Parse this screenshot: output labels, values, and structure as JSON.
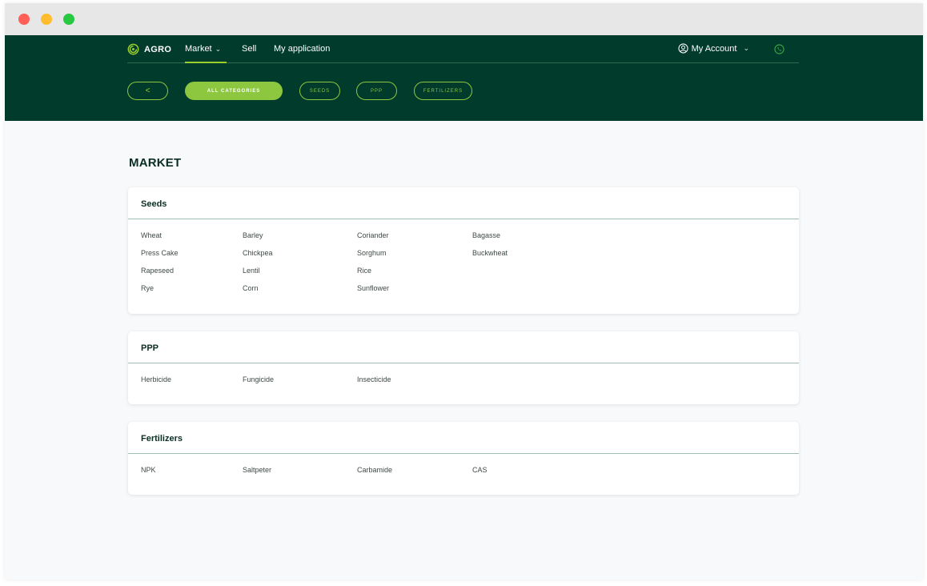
{
  "brand": {
    "name": "AGRO"
  },
  "nav": {
    "market": "Market",
    "sell": "Sell",
    "my_application": "My application",
    "account": "My Account"
  },
  "filters": {
    "back": "<",
    "all_categories": "ALL CATEGORIES",
    "seeds": "SEEDS",
    "ppp": "PPP",
    "fertilizers": "FERTILIZERS"
  },
  "page": {
    "title": "MARKET"
  },
  "categories": [
    {
      "title": "Seeds",
      "items": [
        "Wheat",
        "Barley",
        "Coriander",
        "Bagasse",
        "Press Cake",
        "Chickpea",
        "Sorghum",
        "Buckwheat",
        "Rapeseed",
        "Lentil",
        "Rice",
        "Rye",
        "Corn",
        "Sunflower"
      ]
    },
    {
      "title": "PPP",
      "items": [
        "Herbicide",
        "Fungicide",
        "Insecticide"
      ]
    },
    {
      "title": "Fertilizers",
      "items": [
        "NPK",
        "Saltpeter",
        "Carbamide",
        "CAS"
      ]
    }
  ],
  "colors": {
    "header_bg": "#003b2c",
    "accent": "#8dc63f",
    "page_bg": "#f7f9fb",
    "title_text": "#0b2e24"
  },
  "icons": [
    "agro-logo-icon",
    "chevron-down-icon",
    "user-circle-icon",
    "phone-icon",
    "chevron-left-icon"
  ]
}
